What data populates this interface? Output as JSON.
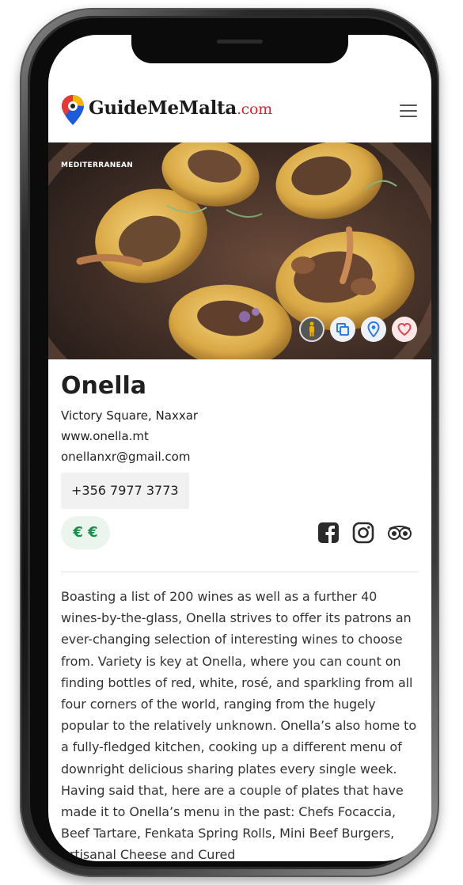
{
  "header": {
    "brand_main": "GuideMeMalta",
    "brand_suffix": ".com"
  },
  "hero": {
    "category_badge": "MEDITERRANEAN",
    "actions": [
      "accessibility-icon",
      "copy-icon",
      "location-pin-icon",
      "heart-icon"
    ]
  },
  "listing": {
    "name": "Onella",
    "address": "Victory Square, Naxxar",
    "website": "www.onella.mt",
    "email": "onellanxr@gmail.com",
    "phone": "+356 7977 3773",
    "price_level": "€ €",
    "social": [
      "facebook-icon",
      "instagram-icon",
      "tripadvisor-icon"
    ],
    "description": "Boasting a list of 200 wines as well as a further 40 wines-by-the-glass, Onella strives to offer its patrons an ever-changing selection of interesting wines to choose from. Variety is key at Onella, where you can count on finding bottles of red, white, rosé, and sparkling from all four corners of the world, ranging from the hugely popular to the relatively unknown. Onella’s also home to a fully-fledged kitchen, cooking up a different menu of downright delicious sharing plates every single week. Having said that, here are a couple of plates that have made it to Onella’s menu in the past: Chefs Focaccia, Beef Tartare, Fenkata Spring Rolls, Mini Beef Burgers, Artisanal Cheese and Cured"
  },
  "colors": {
    "brand_red": "#d9232e",
    "price_green": "#1a8f4a",
    "action_blue": "#2d7de0",
    "heart_red": "#e0454f"
  }
}
